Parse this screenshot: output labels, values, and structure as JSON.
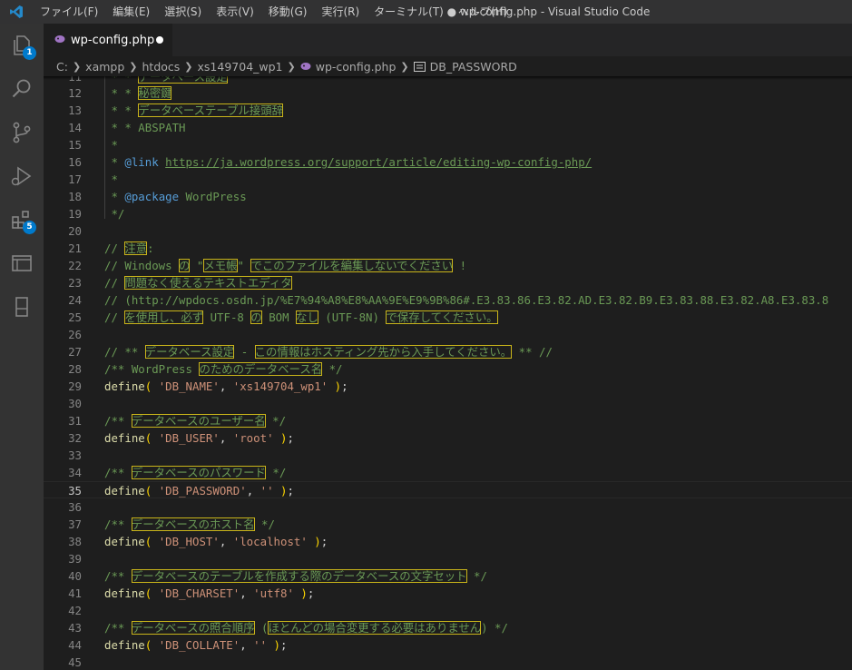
{
  "titlebar": {
    "menu": [
      "ファイル(F)",
      "編集(E)",
      "選択(S)",
      "表示(V)",
      "移動(G)",
      "実行(R)",
      "ターミナル(T)",
      "ヘルプ(H)"
    ],
    "window_title": "● wp-config.php - Visual Studio Code"
  },
  "activity": {
    "explorer_badge": "1",
    "extensions_badge": "5"
  },
  "tab": {
    "label": "wp-config.php"
  },
  "breadcrumb": {
    "items": [
      "C:",
      "xampp",
      "htdocs",
      "xs149704_wp1",
      "wp-config.php",
      "DB_PASSWORD"
    ]
  },
  "editor": {
    "active_line": 35,
    "line_numbers": [
      "11",
      "12",
      "13",
      "14",
      "15",
      "16",
      "17",
      "18",
      "19",
      "20",
      "21",
      "22",
      "23",
      "24",
      "25",
      "26",
      "27",
      "28",
      "29",
      "30",
      "31",
      "32",
      "33",
      "34",
      "35",
      "36",
      "37",
      "38",
      "39",
      "40",
      "41",
      "42",
      "43",
      "44",
      "45"
    ],
    "lines": {
      "l12a": " * * ",
      "l12b": "秘密鍵",
      "l13a": " * * ",
      "l13b": "データベーステーブル接頭辞",
      "l14": " * * ABSPATH",
      "l15": " *",
      "l16a": " * ",
      "l16b": "@link",
      "l16c": " ",
      "l16d": "https://ja.wordpress.org/support/article/editing-wp-config-php/",
      "l17": " *",
      "l18a": " * ",
      "l18b": "@package",
      "l18c": " WordPress",
      "l19": " */",
      "l21a": "// ",
      "l21b": "注意",
      "l21c": ":",
      "l22a": "// Windows ",
      "l22b": "の",
      "l22c": " \"",
      "l22d": "メモ帳",
      "l22e": "\" ",
      "l22f": "でこのファイルを編集しないでください",
      "l22g": " !",
      "l23a": "// ",
      "l23b": "問題なく使えるテキストエディタ",
      "l24": "// (http://wpdocs.osdn.jp/%E7%94%A8%E8%AA%9E%E9%9B%86#.E3.83.86.E3.82.AD.E3.82.B9.E3.83.88.E3.82.A8.E3.83.8",
      "l25a": "// ",
      "l25b": "を使用し、必ず",
      "l25c": " UTF-8 ",
      "l25d": "の",
      "l25e": " BOM ",
      "l25f": "なし",
      "l25g": " (UTF-8N) ",
      "l25h": "で保存してください。",
      "l27a": "// ** ",
      "l27b": "データベース設定",
      "l27c": " - ",
      "l27d": "この情報はホスティング先から入手してください。",
      "l27e": " ** //",
      "l28a": "/** WordPress ",
      "l28b": "のためのデータベース名",
      "l28c": " */",
      "l29_fn": "define",
      "l29_key": "'DB_NAME'",
      "l29_val": "'xs149704_wp1'",
      "l31a": "/** ",
      "l31b": "データベースのユーザー名",
      "l31c": " */",
      "l32_fn": "define",
      "l32_key": "'DB_USER'",
      "l32_val": "'root'",
      "l34a": "/** ",
      "l34b": "データベースのパスワード",
      "l34c": " */",
      "l35_fn": "define",
      "l35_key": "'DB_PASSWORD'",
      "l35_val": "''",
      "l37a": "/** ",
      "l37b": "データベースのホスト名",
      "l37c": " */",
      "l38_fn": "define",
      "l38_key": "'DB_HOST'",
      "l38_val": "'localhost'",
      "l40a": "/** ",
      "l40b": "データベースのテーブルを作成する際のデータベースの文字セット",
      "l40c": " */",
      "l41_fn": "define",
      "l41_key": "'DB_CHARSET'",
      "l41_val": "'utf8'",
      "l43a": "/** ",
      "l43b": "データベースの照合順序",
      "l43c": " (",
      "l43d": "ほとんどの場合変更する必要はありません",
      "l43e": ") */",
      "l44_fn": "define",
      "l44_key": "'DB_COLLATE'",
      "l44_val": "''"
    }
  }
}
